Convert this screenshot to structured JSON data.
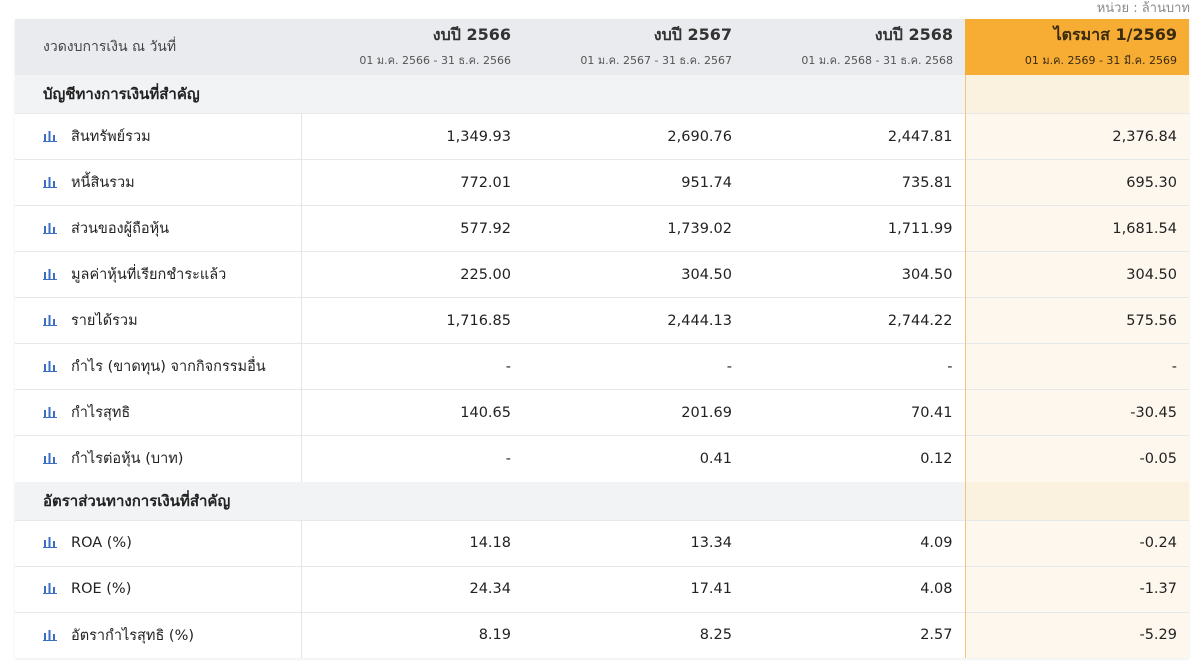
{
  "unit_note": "หน่วย : ล้านบาท",
  "header": {
    "label": "งวดงบการเงิน ณ วันที่",
    "columns": [
      {
        "title": "งบปี 2566",
        "range": "01 ม.ค. 2566 - 31 ธ.ค. 2566"
      },
      {
        "title": "งบปี 2567",
        "range": "01 ม.ค. 2567 - 31 ธ.ค. 2567"
      },
      {
        "title": "งบปี 2568",
        "range": "01 ม.ค. 2568 - 31 ธ.ค. 2568"
      },
      {
        "title": "ไตรมาส 1/2569",
        "range": "01 ม.ค. 2569 - 31 มี.ค. 2569"
      }
    ]
  },
  "colors": {
    "header_bg": "#e9ebee",
    "highlight": "#f7ad34",
    "highlight_cell": "#fdf7ee",
    "icon": "#3b6fc4"
  },
  "sections": [
    {
      "title": "บัญชีทางการเงินที่สำคัญ",
      "rows": [
        {
          "label": "สินทรัพย์รวม",
          "icon": "bar-chart-icon",
          "values": [
            "1,349.93",
            "2,690.76",
            "2,447.81",
            "2,376.84"
          ]
        },
        {
          "label": "หนี้สินรวม",
          "icon": "bar-chart-icon",
          "values": [
            "772.01",
            "951.74",
            "735.81",
            "695.30"
          ]
        },
        {
          "label": "ส่วนของผู้ถือหุ้น",
          "icon": "bar-chart-icon",
          "values": [
            "577.92",
            "1,739.02",
            "1,711.99",
            "1,681.54"
          ]
        },
        {
          "label": "มูลค่าหุ้นที่เรียกชำระแล้ว",
          "icon": "bar-chart-icon",
          "values": [
            "225.00",
            "304.50",
            "304.50",
            "304.50"
          ]
        },
        {
          "label": "รายได้รวม",
          "icon": "bar-chart-icon",
          "values": [
            "1,716.85",
            "2,444.13",
            "2,744.22",
            "575.56"
          ]
        },
        {
          "label": "กำไร (ขาดทุน) จากกิจกรรมอื่น",
          "icon": "bar-chart-icon",
          "values": [
            "-",
            "-",
            "-",
            "-"
          ]
        },
        {
          "label": "กำไรสุทธิ",
          "icon": "bar-chart-icon",
          "values": [
            "140.65",
            "201.69",
            "70.41",
            "-30.45"
          ]
        },
        {
          "label": "กำไรต่อหุ้น (บาท)",
          "icon": "bar-chart-icon",
          "values": [
            "-",
            "0.41",
            "0.12",
            "-0.05"
          ]
        }
      ]
    },
    {
      "title": "อัตราส่วนทางการเงินที่สำคัญ",
      "rows": [
        {
          "label": "ROA (%)",
          "icon": "bar-chart-icon",
          "values": [
            "14.18",
            "13.34",
            "4.09",
            "-0.24"
          ]
        },
        {
          "label": "ROE (%)",
          "icon": "bar-chart-icon",
          "values": [
            "24.34",
            "17.41",
            "4.08",
            "-1.37"
          ]
        },
        {
          "label": "อัตรากำไรสุทธิ (%)",
          "icon": "bar-chart-icon",
          "values": [
            "8.19",
            "8.25",
            "2.57",
            "-5.29"
          ]
        }
      ]
    }
  ]
}
